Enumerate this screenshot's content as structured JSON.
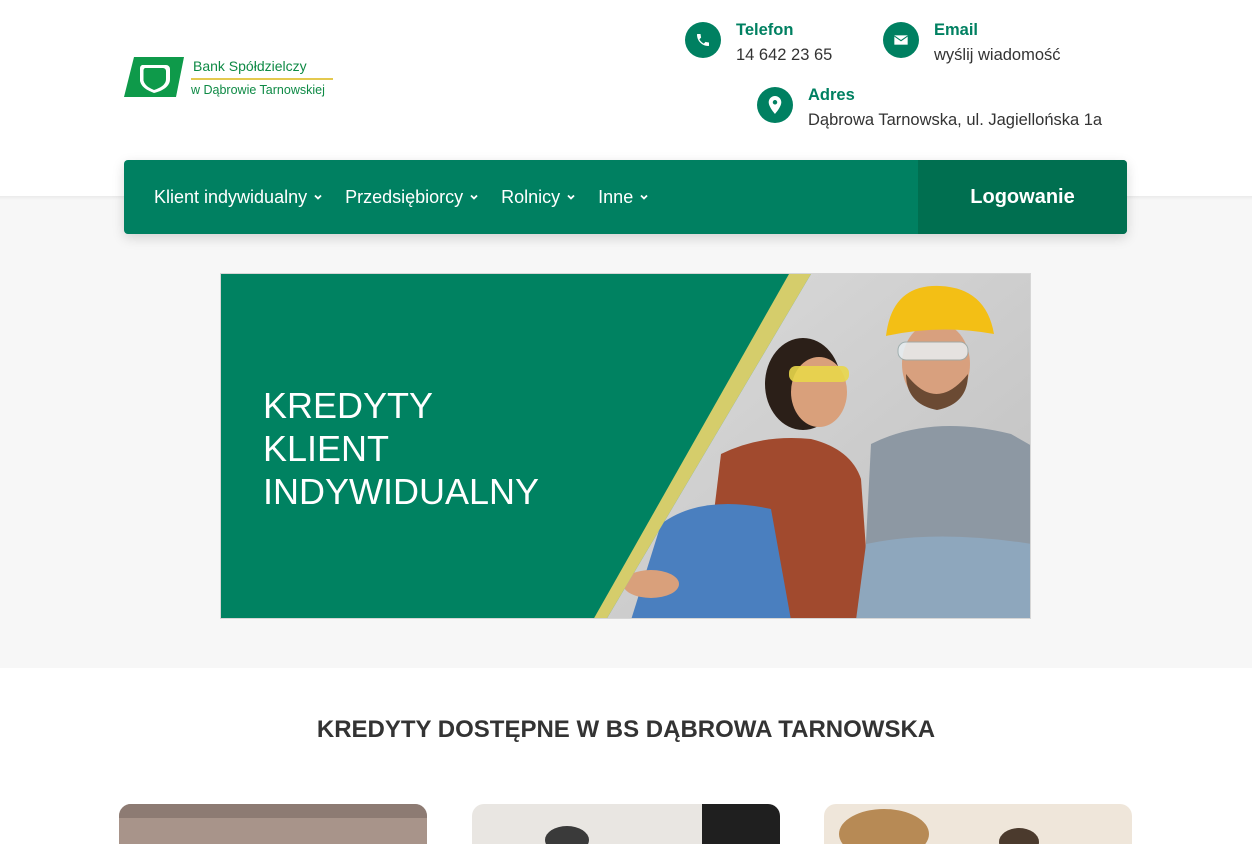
{
  "logo": {
    "line1": "Bank Spółdzielczy",
    "line2": "w Dąbrowie Tarnowskiej"
  },
  "contacts": {
    "phone": {
      "label": "Telefon",
      "value": "14 642 23 65",
      "icon": "phone-icon"
    },
    "email": {
      "label": "Email",
      "value": "wyślij wiadomość",
      "icon": "envelope-icon"
    },
    "address": {
      "label": "Adres",
      "value": "Dąbrowa Tarnowska, ul. Jagiellońska 1a",
      "icon": "map-pin-icon"
    }
  },
  "nav": {
    "items": [
      {
        "label": "Klient indywidualny"
      },
      {
        "label": "Przedsiębiorcy"
      },
      {
        "label": "Rolnicy"
      },
      {
        "label": "Inne"
      }
    ],
    "login_label": "Logowanie"
  },
  "hero": {
    "title_lines": [
      "KREDYTY",
      "KLIENT",
      "INDYWIDUALNY"
    ]
  },
  "section": {
    "heading": "KREDYTY DOSTĘPNE W BS DĄBROWA TARNOWSKA"
  },
  "colors": {
    "brand_green": "#008061",
    "brand_dark_green": "#006f50",
    "logo_green": "#0e8a45",
    "accent_yellow": "#d5cd6b"
  }
}
